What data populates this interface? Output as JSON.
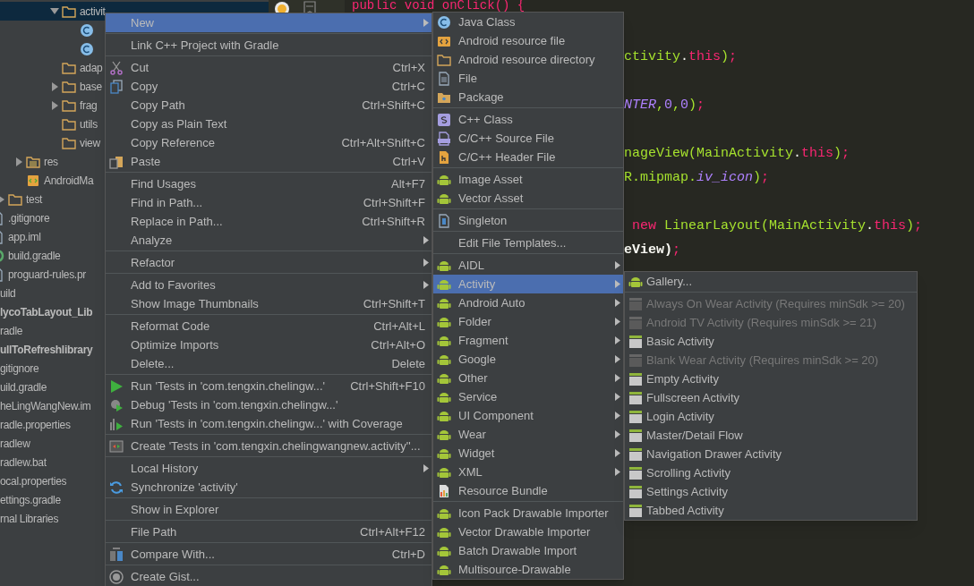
{
  "project_tree": [
    {
      "children": [
        {
          "children": [
            {
              "children": [
                {
                  "children": [
                    {
                      "children": [
                        {
                          "label": "activit",
                          "kind": "folder",
                          "expanded": true,
                          "selected": true,
                          "children": [
                            {
                              "kind": "class",
                              "selected": false
                            },
                            {
                              "kind": "class",
                              "selected": false
                            }
                          ]
                        },
                        {
                          "label": "adap",
                          "kind": "folder",
                          "selected": false
                        },
                        {
                          "label": "base",
                          "kind": "folder",
                          "expanded": false,
                          "selected": false
                        },
                        {
                          "label": "frag",
                          "kind": "folder",
                          "expanded": false,
                          "selected": false
                        },
                        {
                          "label": "utils",
                          "kind": "folder",
                          "selected": false
                        },
                        {
                          "label": "view",
                          "kind": "folder",
                          "selected": false
                        }
                      ]
                    }
                  ]
                },
                {
                  "label": "res",
                  "kind": "res-folder",
                  "expanded": false,
                  "selected": false
                },
                {
                  "label": "AndroidMa",
                  "kind": "manifest",
                  "selected": false
                }
              ]
            },
            {
              "label": "test",
              "kind": "folder",
              "expanded": false,
              "selected": false
            }
          ]
        },
        {
          "label": ".gitignore",
          "kind": "file",
          "selected": false
        },
        {
          "label": "app.iml",
          "kind": "iml",
          "selected": false
        },
        {
          "label": "build.gradle",
          "kind": "gradle",
          "selected": false
        },
        {
          "label": "proguard-rules.pr",
          "kind": "file",
          "selected": false
        }
      ]
    },
    {
      "label": "uild",
      "kind": "folder",
      "selected": false
    },
    {
      "label": "lycoTabLayout_Lib",
      "kind": "module",
      "selected": false
    },
    {
      "label": "radle",
      "kind": "folder",
      "selected": false
    },
    {
      "label": "ullToRefreshlibrary",
      "kind": "module",
      "selected": false
    },
    {
      "label": "gitignore",
      "kind": "file",
      "selected": false
    },
    {
      "label": "uild.gradle",
      "kind": "file",
      "selected": false
    },
    {
      "label": "heLingWangNew.im",
      "kind": "file",
      "selected": false
    },
    {
      "label": "radle.properties",
      "kind": "file",
      "selected": false
    },
    {
      "label": "radlew",
      "kind": "file",
      "selected": false
    },
    {
      "label": "radlew.bat",
      "kind": "file",
      "selected": false
    },
    {
      "label": "ocal.properties",
      "kind": "file",
      "selected": false
    },
    {
      "label": "ettings.gradle",
      "kind": "file",
      "selected": false
    },
    {
      "label": "rnal Libraries",
      "kind": "file",
      "selected": false
    }
  ],
  "editor": {
    "lines": [
      {
        "covered": false,
        "after_blank": false,
        "tokens": [
          {
            "text": "public void onClick() {",
            "kind": "keyword"
          }
        ]
      },
      {
        "covered": true,
        "after_blank": true,
        "tokens": [
          {
            "text": "ctivity",
            "kind": "ident"
          },
          {
            "text": ".",
            "kind": "plain"
          },
          {
            "text": "this",
            "kind": "keyword"
          },
          {
            "text": ")",
            "kind": "ident"
          },
          {
            "text": ";",
            "kind": "keyword"
          }
        ]
      },
      {
        "covered": true,
        "after_blank": true,
        "tokens": [
          {
            "text": "NTER",
            "kind": "const"
          },
          {
            "text": ",",
            "kind": "ident"
          },
          {
            "text": "0",
            "kind": "number"
          },
          {
            "text": ",",
            "kind": "ident"
          },
          {
            "text": "0",
            "kind": "number"
          },
          {
            "text": ")",
            "kind": "ident"
          },
          {
            "text": ";",
            "kind": "keyword"
          }
        ]
      },
      {
        "covered": true,
        "after_blank": true,
        "tokens": [
          {
            "text": "nageView(MainActivity",
            "kind": "ident"
          },
          {
            "text": ".",
            "kind": "plain"
          },
          {
            "text": "this",
            "kind": "keyword"
          },
          {
            "text": ")",
            "kind": "ident"
          },
          {
            "text": ";",
            "kind": "keyword"
          }
        ]
      },
      {
        "covered": true,
        "after_blank": false,
        "tokens": [
          {
            "text": "R.mipmap.",
            "kind": "ident"
          },
          {
            "text": "iv_icon",
            "kind": "const"
          },
          {
            "text": ")",
            "kind": "ident"
          },
          {
            "text": ";",
            "kind": "keyword"
          }
        ]
      },
      {
        "covered": true,
        "after_blank": true,
        "tokens": [
          {
            "text": " new",
            "kind": "keyword"
          },
          {
            "text": " LinearLayout(MainActivity",
            "kind": "ident"
          },
          {
            "text": ".",
            "kind": "plain"
          },
          {
            "text": "this",
            "kind": "keyword"
          },
          {
            "text": ")",
            "kind": "ident"
          },
          {
            "text": ";",
            "kind": "keyword"
          }
        ]
      },
      {
        "covered": true,
        "after_blank": false,
        "tokens": [
          {
            "text": "eView)",
            "kind": "strong"
          },
          {
            "text": ";",
            "kind": "keyword"
          }
        ]
      }
    ]
  },
  "context_menu": {
    "groups": [
      {
        "items": [
          {
            "label": "New",
            "selected": true,
            "submenu": true
          }
        ]
      },
      {
        "items": [
          {
            "label": "Link C++ Project with Gradle",
            "selected": false,
            "submenu": false
          }
        ]
      },
      {
        "items": [
          {
            "label": "Cut",
            "kind": "scissors",
            "shortcut": "Ctrl+X",
            "selected": false,
            "submenu": false
          },
          {
            "label": "Copy",
            "kind": "copy",
            "shortcut": "Ctrl+C",
            "selected": false,
            "submenu": false
          },
          {
            "label": "Copy Path",
            "shortcut": "Ctrl+Shift+C",
            "selected": false,
            "submenu": false
          },
          {
            "label": "Copy as Plain Text",
            "selected": false,
            "submenu": false
          },
          {
            "label": "Copy Reference",
            "shortcut": "Ctrl+Alt+Shift+C",
            "selected": false,
            "submenu": false
          },
          {
            "label": "Paste",
            "kind": "paste",
            "shortcut": "Ctrl+V",
            "selected": false,
            "submenu": false
          }
        ]
      },
      {
        "items": [
          {
            "label": "Find Usages",
            "shortcut": "Alt+F7",
            "selected": false,
            "submenu": false
          },
          {
            "label": "Find in Path...",
            "shortcut": "Ctrl+Shift+F",
            "selected": false,
            "submenu": false
          },
          {
            "label": "Replace in Path...",
            "shortcut": "Ctrl+Shift+R",
            "selected": false,
            "submenu": false
          },
          {
            "label": "Analyze",
            "selected": false,
            "submenu": true
          }
        ]
      },
      {
        "items": [
          {
            "label": "Refactor",
            "selected": false,
            "submenu": true
          }
        ]
      },
      {
        "items": [
          {
            "label": "Add to Favorites",
            "selected": false,
            "submenu": true
          },
          {
            "label": "Show Image Thumbnails",
            "shortcut": "Ctrl+Shift+T",
            "selected": false,
            "submenu": false
          }
        ]
      },
      {
        "items": [
          {
            "label": "Reformat Code",
            "shortcut": "Ctrl+Alt+L",
            "selected": false,
            "submenu": false
          },
          {
            "label": "Optimize Imports",
            "shortcut": "Ctrl+Alt+O",
            "selected": false,
            "submenu": false
          },
          {
            "label": "Delete...",
            "shortcut": "Delete",
            "selected": false,
            "submenu": false
          }
        ]
      },
      {
        "items": [
          {
            "label": "Run 'Tests in 'com.tengxin.chelingw...'",
            "kind": "run",
            "shortcut": "Ctrl+Shift+F10",
            "selected": false,
            "submenu": false
          },
          {
            "label": "Debug 'Tests in 'com.tengxin.chelingw...'",
            "kind": "debug",
            "selected": false,
            "submenu": false
          },
          {
            "label": "Run 'Tests in 'com.tengxin.chelingw...' with Coverage",
            "kind": "coverage",
            "selected": false,
            "submenu": false
          }
        ]
      },
      {
        "items": [
          {
            "label": "Create 'Tests in 'com.tengxin.chelingwangnew.activity''...",
            "kind": "test",
            "selected": false,
            "submenu": false
          }
        ]
      },
      {
        "items": [
          {
            "label": "Local History",
            "selected": false,
            "submenu": true
          },
          {
            "label": "Synchronize 'activity'",
            "kind": "sync",
            "selected": false,
            "submenu": false
          }
        ]
      },
      {
        "items": [
          {
            "label": "Show in Explorer",
            "selected": false,
            "submenu": false
          }
        ]
      },
      {
        "items": [
          {
            "label": "File Path",
            "shortcut": "Ctrl+Alt+F12",
            "selected": false,
            "submenu": false
          }
        ]
      },
      {
        "items": [
          {
            "label": "Compare With...",
            "kind": "compare",
            "shortcut": "Ctrl+D",
            "selected": false,
            "submenu": false
          }
        ]
      },
      {
        "items": [
          {
            "label": "Create Gist...",
            "kind": "gist",
            "selected": false,
            "submenu": false
          }
        ]
      }
    ]
  },
  "new_submenu": {
    "groups": [
      {
        "items": [
          {
            "label": "Java Class",
            "kind": "java-class",
            "selected": false,
            "submenu": false
          },
          {
            "label": "Android resource file",
            "kind": "res-file",
            "selected": false,
            "submenu": false
          },
          {
            "label": "Android resource directory",
            "kind": "folder",
            "selected": false,
            "submenu": false
          },
          {
            "label": "File",
            "kind": "file",
            "selected": false,
            "submenu": false
          },
          {
            "label": "Package",
            "kind": "package",
            "selected": false,
            "submenu": false
          }
        ]
      },
      {
        "items": [
          {
            "label": "C++ Class",
            "kind": "cpp-class",
            "selected": false,
            "submenu": false
          },
          {
            "label": "C/C++ Source File",
            "kind": "cpp-source",
            "selected": false,
            "submenu": false
          },
          {
            "label": "C/C++ Header File",
            "kind": "cpp-header",
            "selected": false,
            "submenu": false
          }
        ]
      },
      {
        "items": [
          {
            "label": "Image Asset",
            "kind": "android",
            "selected": false,
            "submenu": false
          },
          {
            "label": "Vector Asset",
            "kind": "android",
            "selected": false,
            "submenu": false
          }
        ]
      },
      {
        "items": [
          {
            "label": "Singleton",
            "kind": "singleton",
            "selected": false,
            "submenu": false
          }
        ]
      },
      {
        "items": [
          {
            "label": "Edit File Templates...",
            "selected": false,
            "submenu": false
          }
        ]
      },
      {
        "items": [
          {
            "label": "AIDL",
            "kind": "android",
            "selected": false,
            "submenu": true
          },
          {
            "label": "Activity",
            "kind": "android",
            "selected": true,
            "submenu": true
          },
          {
            "label": "Android Auto",
            "kind": "android",
            "selected": false,
            "submenu": true
          },
          {
            "label": "Folder",
            "kind": "android",
            "selected": false,
            "submenu": true
          },
          {
            "label": "Fragment",
            "kind": "android",
            "selected": false,
            "submenu": true
          },
          {
            "label": "Google",
            "kind": "android",
            "selected": false,
            "submenu": true
          },
          {
            "label": "Other",
            "kind": "android",
            "selected": false,
            "submenu": true
          },
          {
            "label": "Service",
            "kind": "android",
            "selected": false,
            "submenu": true
          },
          {
            "label": "UI Component",
            "kind": "android",
            "selected": false,
            "submenu": true
          },
          {
            "label": "Wear",
            "kind": "android",
            "selected": false,
            "submenu": true
          },
          {
            "label": "Widget",
            "kind": "android",
            "selected": false,
            "submenu": true
          },
          {
            "label": "XML",
            "kind": "android",
            "selected": false,
            "submenu": true
          },
          {
            "label": "Resource Bundle",
            "kind": "bundle",
            "selected": false,
            "submenu": false
          }
        ]
      },
      {
        "items": [
          {
            "label": "Icon Pack Drawable Importer",
            "kind": "android",
            "selected": false,
            "submenu": false
          },
          {
            "label": "Vector Drawable Importer",
            "kind": "android",
            "selected": false,
            "submenu": false
          },
          {
            "label": "Batch Drawable Import",
            "kind": "android",
            "selected": false,
            "submenu": false
          },
          {
            "label": "Multisource-Drawable",
            "kind": "android",
            "selected": false,
            "submenu": false
          }
        ]
      }
    ]
  },
  "activity_submenu": {
    "groups": [
      {
        "items": [
          {
            "label": "Gallery...",
            "kind": "android",
            "disabled": false,
            "selected": false,
            "submenu": false
          }
        ]
      },
      {
        "items": [
          {
            "label": "Always On Wear Activity (Requires minSdk >= 20)",
            "kind": "template",
            "disabled": true,
            "selected": false,
            "submenu": false
          },
          {
            "label": "Android TV Activity (Requires minSdk >= 21)",
            "kind": "template",
            "disabled": true,
            "selected": false,
            "submenu": false
          },
          {
            "label": "Basic Activity",
            "kind": "template",
            "disabled": false,
            "selected": false,
            "submenu": false
          },
          {
            "label": "Blank Wear Activity (Requires minSdk >= 20)",
            "kind": "template",
            "disabled": true,
            "selected": false,
            "submenu": false
          },
          {
            "label": "Empty Activity",
            "kind": "template",
            "disabled": false,
            "selected": false,
            "submenu": false
          },
          {
            "label": "Fullscreen Activity",
            "kind": "template",
            "disabled": false,
            "selected": false,
            "submenu": false
          },
          {
            "label": "Login Activity",
            "kind": "template",
            "disabled": false,
            "selected": false,
            "submenu": false
          },
          {
            "label": "Master/Detail Flow",
            "kind": "template",
            "disabled": false,
            "selected": false,
            "submenu": false
          },
          {
            "label": "Navigation Drawer Activity",
            "kind": "template",
            "disabled": false,
            "selected": false,
            "submenu": false
          },
          {
            "label": "Scrolling Activity",
            "kind": "template",
            "disabled": false,
            "selected": false,
            "submenu": false
          },
          {
            "label": "Settings Activity",
            "kind": "template",
            "disabled": false,
            "selected": false,
            "submenu": false
          },
          {
            "label": "Tabbed Activity",
            "kind": "template",
            "disabled": false,
            "selected": false,
            "submenu": false
          }
        ]
      }
    ]
  }
}
